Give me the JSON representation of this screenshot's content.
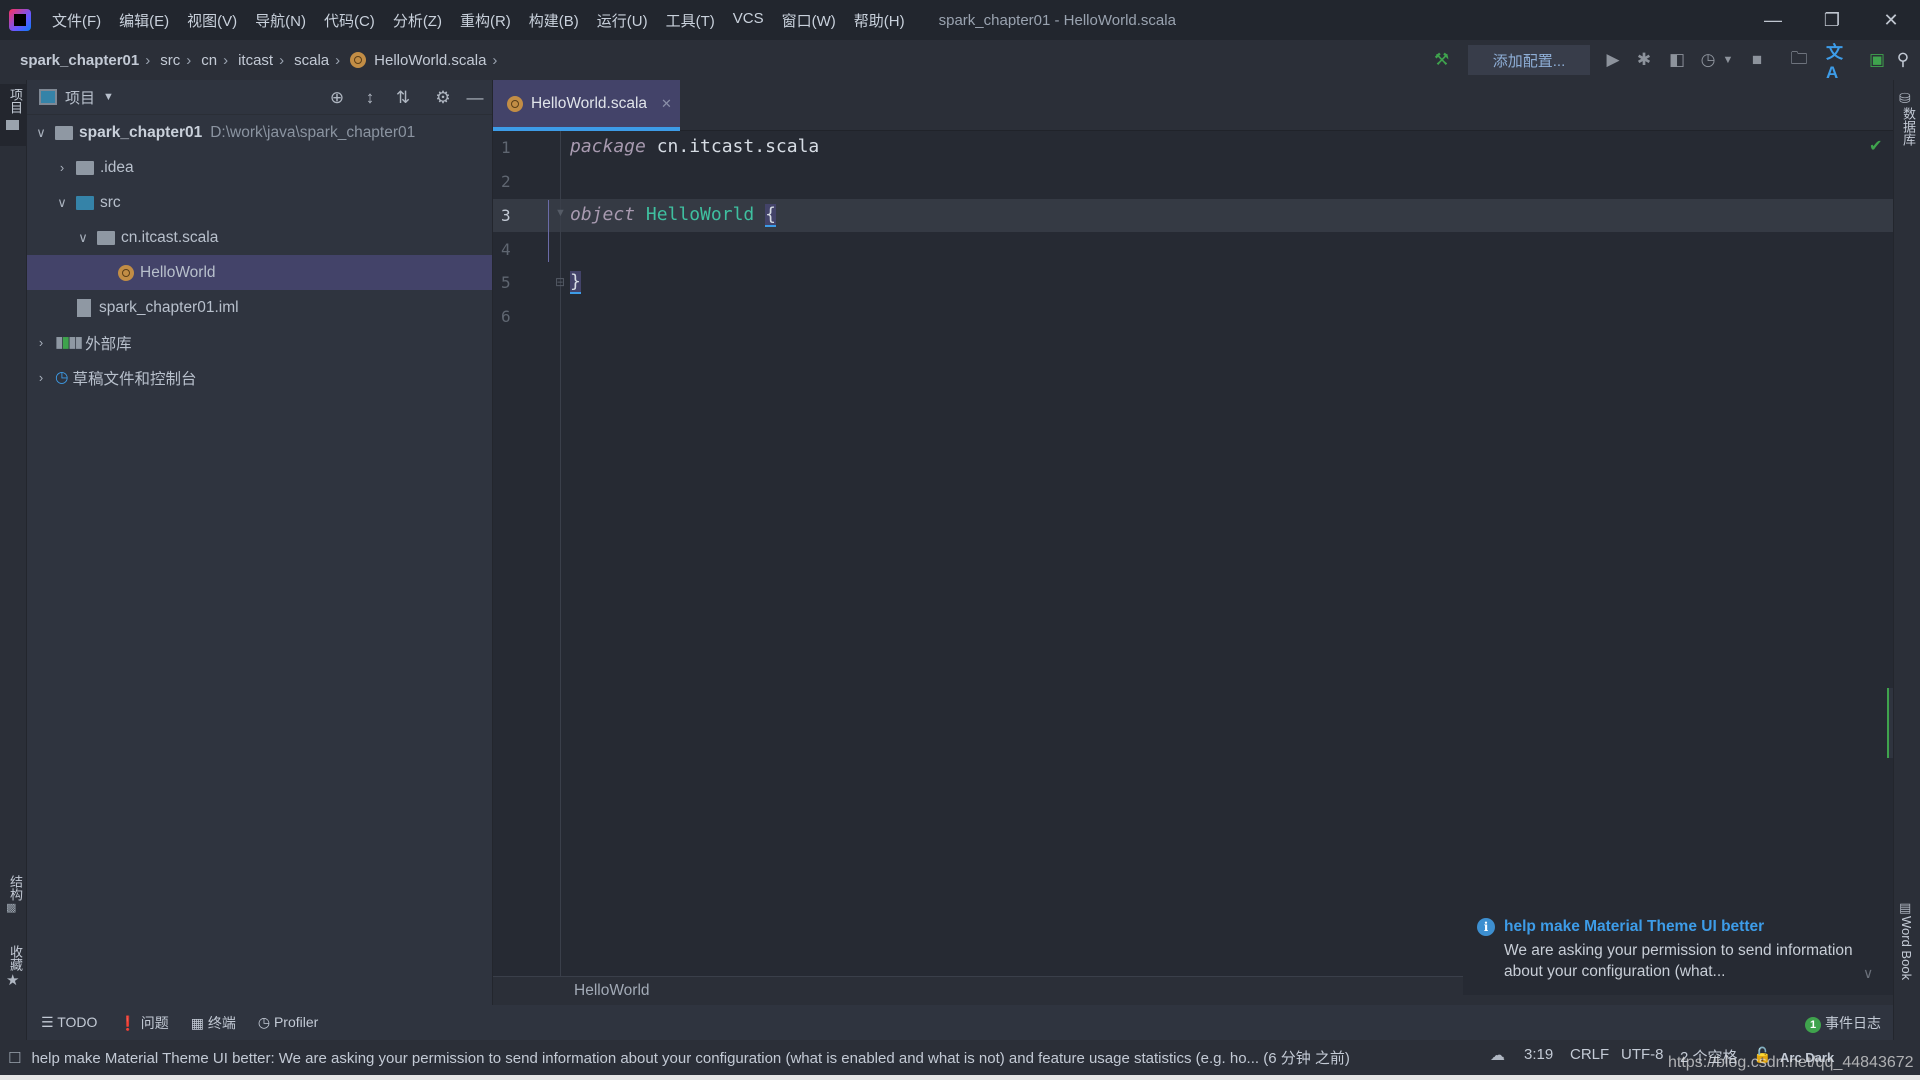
{
  "titlebar": {
    "menu": [
      "文件(F)",
      "编辑(E)",
      "视图(V)",
      "导航(N)",
      "代码(C)",
      "分析(Z)",
      "重构(R)",
      "构建(B)",
      "运行(U)",
      "工具(T)",
      "VCS",
      "窗口(W)",
      "帮助(H)"
    ],
    "title": "spark_chapter01 - HelloWorld.scala"
  },
  "navbar": {
    "crumbs": [
      "spark_chapter01",
      "src",
      "cn",
      "itcast",
      "scala",
      "HelloWorld.scala"
    ],
    "add_config": "添加配置..."
  },
  "left_strip": {
    "project": "项目",
    "structure": "结构",
    "favorites": "收藏"
  },
  "right_strip": {
    "database": "数据库",
    "wordbook": "Word Book"
  },
  "project": {
    "header": "项目",
    "tree": [
      {
        "label": "spark_chapter01",
        "path": "D:\\work\\java\\spark_chapter01",
        "expanded": true
      },
      {
        "label": ".idea",
        "expanded": false
      },
      {
        "label": "src",
        "expanded": true
      },
      {
        "label": "cn.itcast.scala",
        "expanded": true
      },
      {
        "label": "HelloWorld",
        "selected": true
      },
      {
        "label": "spark_chapter01.iml"
      },
      {
        "label": "外部库",
        "expanded": false
      },
      {
        "label": "草稿文件和控制台",
        "expanded": false
      }
    ]
  },
  "editor": {
    "tab": "HelloWorld.scala",
    "line_numbers": [
      "1",
      "2",
      "3",
      "4",
      "5",
      "6"
    ],
    "code": {
      "l1_kw": "package",
      "l1_rest": " cn.itcast.scala",
      "l3_kw": "object",
      "l3_cls": "HelloWorld",
      "l3_brace": "{",
      "l5_brace": "}"
    },
    "breadcrumb": "HelloWorld"
  },
  "notification": {
    "title": "help make Material Theme UI better",
    "body": "We are asking your permission to send information about your configuration (what..."
  },
  "toolwindows": [
    "TODO",
    "问题",
    "终端",
    "Profiler"
  ],
  "event_log": {
    "count": "1",
    "label": "事件日志"
  },
  "status": {
    "message": "help make Material Theme UI better: We are asking your permission to send information about your configuration (what is enabled and what is not) and feature usage statistics (e.g. ho... (6 分钟 之前)",
    "position": "3:19",
    "line_sep": "CRLF",
    "encoding": "UTF-8",
    "indent": "2 个空格",
    "theme": "Arc Dark",
    "watermark": "https://blog.csdn.net/qq_44843672"
  },
  "colors": {
    "accent": "#3d9ce8",
    "selection": "#434369",
    "build_green": "#3fa34d"
  }
}
